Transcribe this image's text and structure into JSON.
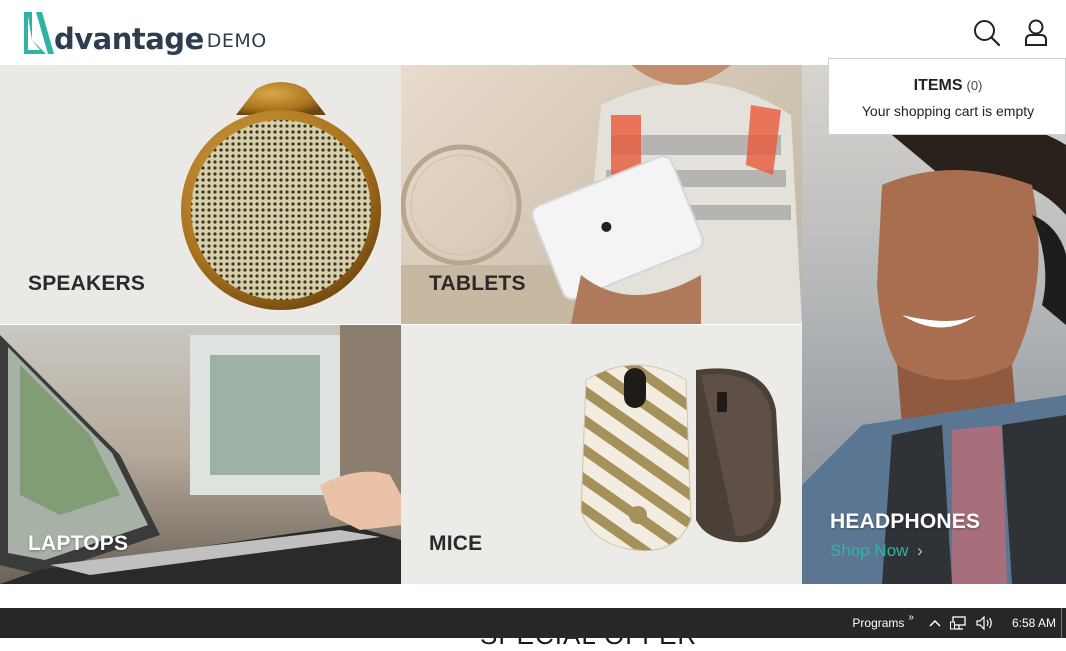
{
  "brand": {
    "word": "dvantage",
    "suffix": "DEMO",
    "accent": "#2fb4a4",
    "text_color": "#2c3e50"
  },
  "header": {
    "icons": [
      "search-icon",
      "user-icon"
    ]
  },
  "cart": {
    "title": "ITEMS",
    "count": "(0)",
    "message": "Your shopping cart is empty"
  },
  "categories": {
    "speakers": "SPEAKERS",
    "tablets": "TABLETS",
    "laptops": "LAPTOPS",
    "mice": "MICE",
    "headphones": "HEADPHONES"
  },
  "promo": {
    "shop_now": "Shop Now",
    "special_offer": "SPECIAL OFFER"
  },
  "taskbar": {
    "programs": "Programs",
    "time": "6:58 AM",
    "icons": [
      "chevron-up-icon",
      "network-icon",
      "volume-icon"
    ]
  }
}
